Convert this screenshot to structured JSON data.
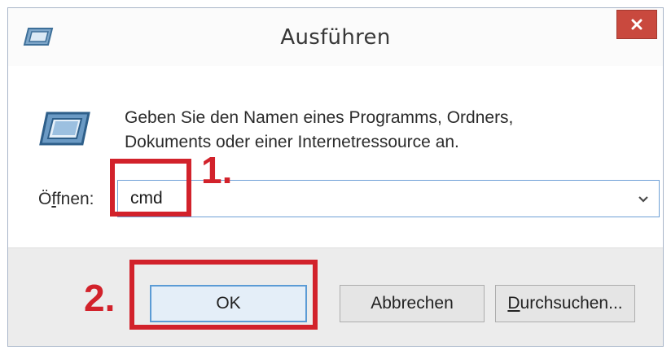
{
  "window": {
    "title": "Ausführen",
    "close_label": "Close"
  },
  "content": {
    "description_line1": "Geben Sie den Namen eines Programms, Ordners,",
    "description_line2": "Dokuments oder einer Internetressource an.",
    "open_label_prefix": "Ö",
    "open_label_accel": "f",
    "open_label_suffix": "fnen:",
    "input_value": "cmd"
  },
  "buttons": {
    "ok": "OK",
    "cancel": "Abbrechen",
    "browse_accel": "D",
    "browse_rest": "urchsuchen..."
  },
  "annotations": {
    "step1": "1.",
    "step2": "2.",
    "highlight_color": "#d2222b"
  },
  "icons": [
    "run-icon",
    "close-icon",
    "dropdown-arrow-icon"
  ]
}
